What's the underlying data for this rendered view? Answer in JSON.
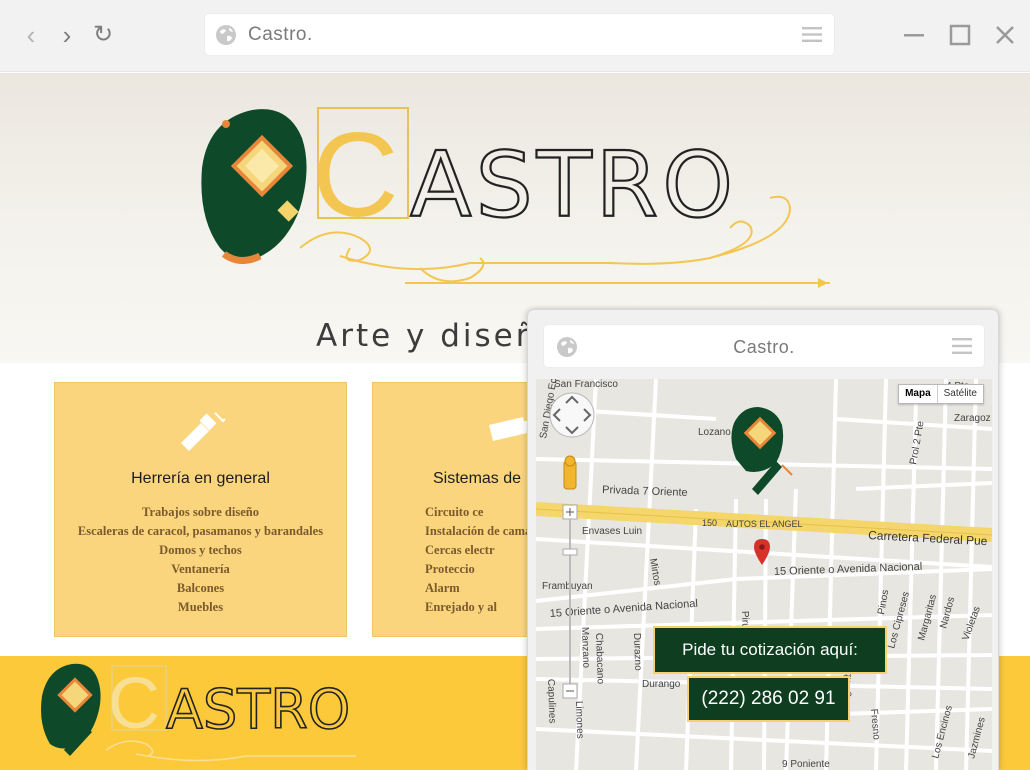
{
  "browser": {
    "title": "Castro.",
    "back_icon": "chevron-left-icon",
    "forward_icon": "chevron-right-icon",
    "reload_icon": "reload-icon",
    "nav_back": "‹",
    "nav_forward": "›",
    "nav_reload": "↻"
  },
  "logo": {
    "text_c": "C",
    "text_rest": "ASTRO"
  },
  "tagline": "Arte y diseño",
  "cards": [
    {
      "title": "Herrería en general",
      "items": [
        "Trabajos sobre diseño",
        "Escaleras de caracol, pasamanos y barandales",
        "Domos y techos",
        "Ventanería",
        "Balcones",
        "Muebles"
      ]
    },
    {
      "title": "Sistemas de",
      "items": [
        "Circuito ce",
        "Instalación de cama",
        "Cercas electr",
        "Proteccio",
        "Alarm",
        "Enrejado y al"
      ]
    }
  ],
  "mobile": {
    "title": "Castro.",
    "map": {
      "type_map": "Mapa",
      "type_satellite": "Satélite",
      "labels": {
        "san_francisco": "San Francisco",
        "lozano": "Lozano",
        "privada": "Privada 7 Oriente",
        "envases": "Envases Luin",
        "route": "150",
        "autos": "AUTOS EL ANGEL",
        "carretera": "Carretera Federal Pue",
        "oriente15a": "15 Oriente o Avenida Nacional",
        "oriente15b": "15 Oriente o Avenida Nacional",
        "frambuyan": "Frambuyan",
        "mirtos": "Mirtos",
        "chabacano": "Chabacano",
        "durazno": "Durazno",
        "manzano": "Manzano",
        "limones": "Limones",
        "capulines": "Capulines",
        "durango": "Durango",
        "pirul": "Pirul",
        "zaragoza": "Zaragoz",
        "cuatro_pte": "4 Pte",
        "prol_dos_pte": "Prol 2 Pte",
        "pinos": "Pinos",
        "los_cipreses": "Los Cipreses",
        "margaritas": "Margaritas",
        "nardos": "Nardos",
        "violetas": "Violetas",
        "los_encinos": "Los Encinos",
        "jazmines": "Jazmines",
        "fresno": "Fresno",
        "bugambilias": "Bugambilias",
        "nueve_poniente": "9 Poniente",
        "san_diego": "San Diego Eca"
      }
    },
    "cta": "Pide tu cotización aquí:",
    "phone": "(222) 286 02 91"
  }
}
